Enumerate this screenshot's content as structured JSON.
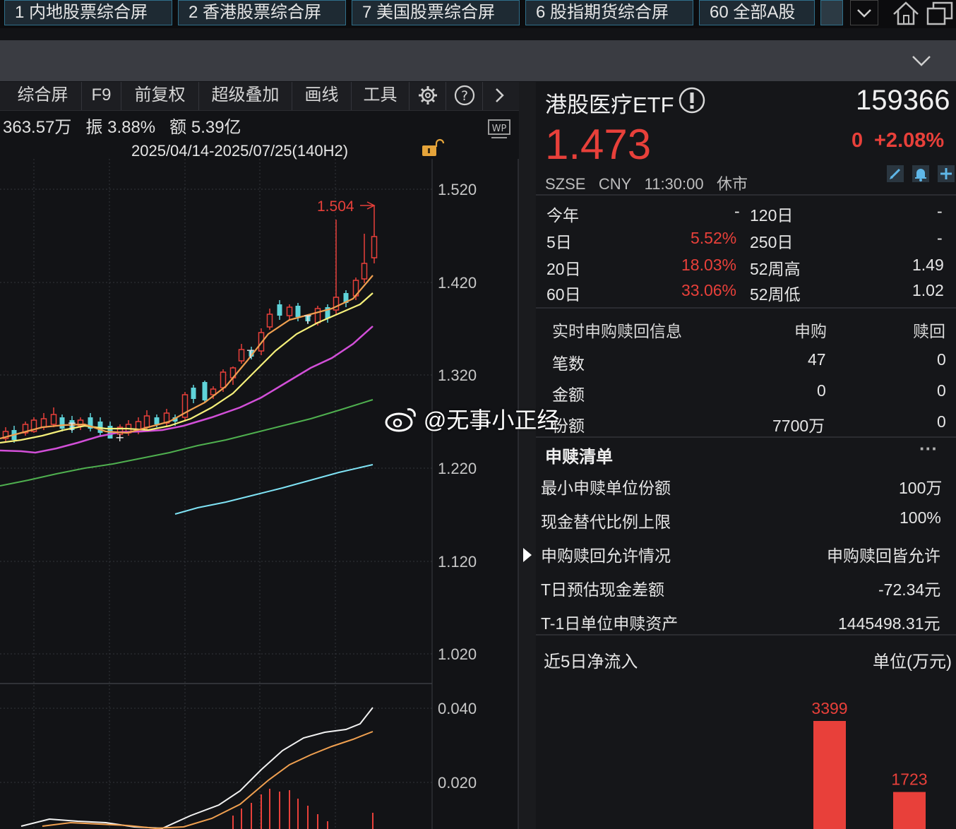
{
  "top_tabs": [
    "1 内地股票综合屏",
    "2 香港股票综合屏",
    "7 美国股票综合屏",
    "6 股指期货综合屏",
    "60 全部A股"
  ],
  "toolbar": [
    "综合屏",
    "F9",
    "前复权",
    "超级叠加",
    "画线",
    "工具"
  ],
  "info_line": {
    "vol": "363.57万",
    "amp_label": "振",
    "amp": "3.88%",
    "amt_label": "额",
    "amt": "5.39亿"
  },
  "range_label": "2025/04/14-2025/07/25(140H2)",
  "wp_badge": "WP",
  "price_axis": [
    "1.520",
    "1.420",
    "1.320",
    "1.220",
    "1.120",
    "1.020"
  ],
  "max_label": "1.504",
  "sub_axis": [
    "0.040",
    "0.020"
  ],
  "stock": {
    "name": "港股医疗ETF",
    "code": "159366",
    "price": "1.473",
    "change": "0",
    "change_pct": "+2.08%",
    "exchange": "SZSE",
    "currency": "CNY",
    "time": "11:30:00",
    "status": "休市"
  },
  "perf": [
    {
      "l1": "今年",
      "v1": "-",
      "l2": "120日",
      "v2": "-"
    },
    {
      "l1": "5日",
      "v1": "5.52%",
      "l2": "250日",
      "v2": "-"
    },
    {
      "l1": "20日",
      "v1": "18.03%",
      "l2": "52周高",
      "v2": "1.49"
    },
    {
      "l1": "60日",
      "v1": "33.06%",
      "l2": "52周低",
      "v2": "1.02"
    }
  ],
  "sub_redeem": {
    "title": "实时申购赎回信息",
    "col1": "申购",
    "col2": "赎回",
    "rows": [
      {
        "label": "笔数",
        "a": "47",
        "b": "0"
      },
      {
        "label": "金额",
        "a": "0",
        "b": "0"
      },
      {
        "label": "份额",
        "a": "7700万",
        "b": "0"
      }
    ]
  },
  "list": {
    "title": "申赎清单",
    "more": "···",
    "rows": [
      {
        "label": "最小申赎单位份额",
        "value": "100万"
      },
      {
        "label": "现金替代比例上限",
        "value": "100%"
      },
      {
        "label": "申购赎回允许情况",
        "value": "申购赎回皆允许"
      },
      {
        "label": "T日预估现金差额",
        "value": "-72.34元"
      },
      {
        "label": "T-1日单位申赎资产",
        "value": "1445498.31元"
      }
    ]
  },
  "flow": {
    "title": "近5日净流入",
    "unit": "单位(万元)"
  },
  "chart_data": {
    "type": "bar",
    "categories": [
      "",
      ""
    ],
    "values": [
      3399,
      1723
    ],
    "title": "近5日净流入",
    "ylabel": "单位(万元)"
  },
  "watermark": "@无事小正经",
  "colors": {
    "up": "#e8403a",
    "down": "#5fd3d9",
    "ma5": "#f0a050",
    "ma10": "#f5f07a",
    "ma20": "#d24fd8",
    "ma60": "#4fb04f",
    "ma120": "#7fe3f5"
  }
}
